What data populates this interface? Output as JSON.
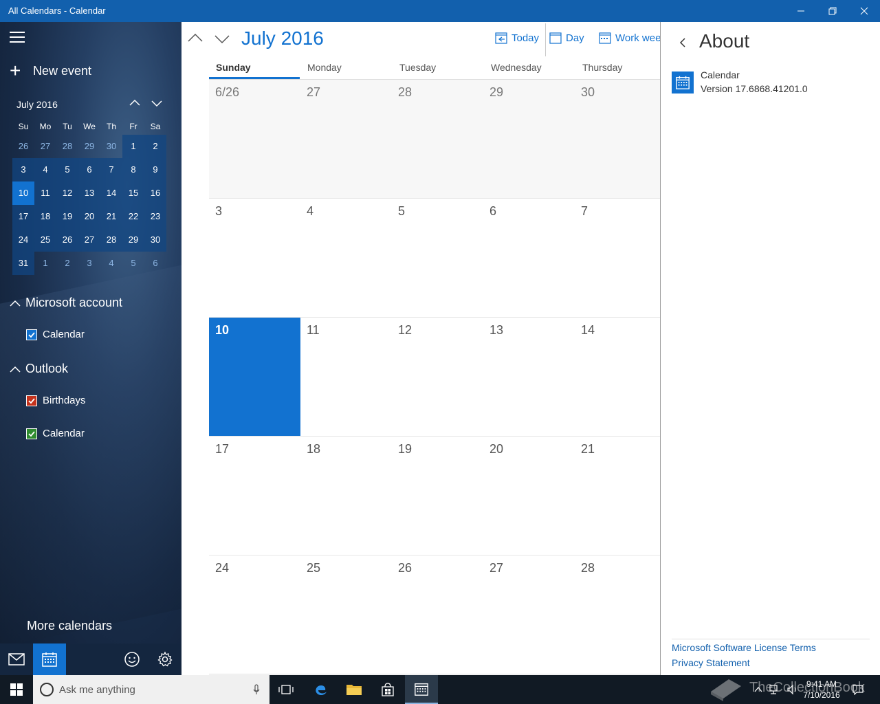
{
  "window": {
    "title": "All Calendars - Calendar"
  },
  "sidebar": {
    "new_event": "New event",
    "mini_calendar": {
      "month_label": "July 2016",
      "day_headers": [
        "Su",
        "Mo",
        "Tu",
        "We",
        "Th",
        "Fr",
        "Sa"
      ],
      "weeks": [
        [
          "26",
          "27",
          "28",
          "29",
          "30",
          "1",
          "2"
        ],
        [
          "3",
          "4",
          "5",
          "6",
          "7",
          "8",
          "9"
        ],
        [
          "10",
          "11",
          "12",
          "13",
          "14",
          "15",
          "16"
        ],
        [
          "17",
          "18",
          "19",
          "20",
          "21",
          "22",
          "23"
        ],
        [
          "24",
          "25",
          "26",
          "27",
          "28",
          "29",
          "30"
        ],
        [
          "31",
          "1",
          "2",
          "3",
          "4",
          "5",
          "6"
        ]
      ]
    },
    "accounts": [
      {
        "name": "Microsoft account",
        "calendars": [
          {
            "label": "Calendar",
            "color": "#1272d0"
          }
        ]
      },
      {
        "name": "Outlook",
        "calendars": [
          {
            "label": "Birthdays",
            "color": "#c4321c"
          },
          {
            "label": "Calendar",
            "color": "#2f8c2f"
          }
        ]
      }
    ],
    "more_calendars": "More calendars"
  },
  "main": {
    "month_title": "July 2016",
    "views": {
      "today": "Today",
      "day": "Day",
      "work_week": "Work week"
    },
    "weekdays": [
      "Sunday",
      "Monday",
      "Tuesday",
      "Wednesday",
      "Thursday"
    ],
    "weeks": [
      [
        "6/26",
        "27",
        "28",
        "29",
        "30"
      ],
      [
        "3",
        "4",
        "5",
        "6",
        "7"
      ],
      [
        "10",
        "11",
        "12",
        "13",
        "14"
      ],
      [
        "17",
        "18",
        "19",
        "20",
        "21"
      ],
      [
        "24",
        "25",
        "26",
        "27",
        "28"
      ]
    ]
  },
  "about": {
    "title": "About",
    "app_name": "Calendar",
    "version": "Version 17.6868.41201.0",
    "license_link": "Microsoft Software License Terms",
    "privacy_link": "Privacy Statement"
  },
  "taskbar": {
    "search_placeholder": "Ask me anything",
    "time": "9:41 AM",
    "date": "7/10/2016"
  },
  "watermark": "TheCollectionBook",
  "colors": {
    "accent": "#1272d0",
    "titlebar": "#1260ad",
    "taskbar": "#111a24"
  }
}
